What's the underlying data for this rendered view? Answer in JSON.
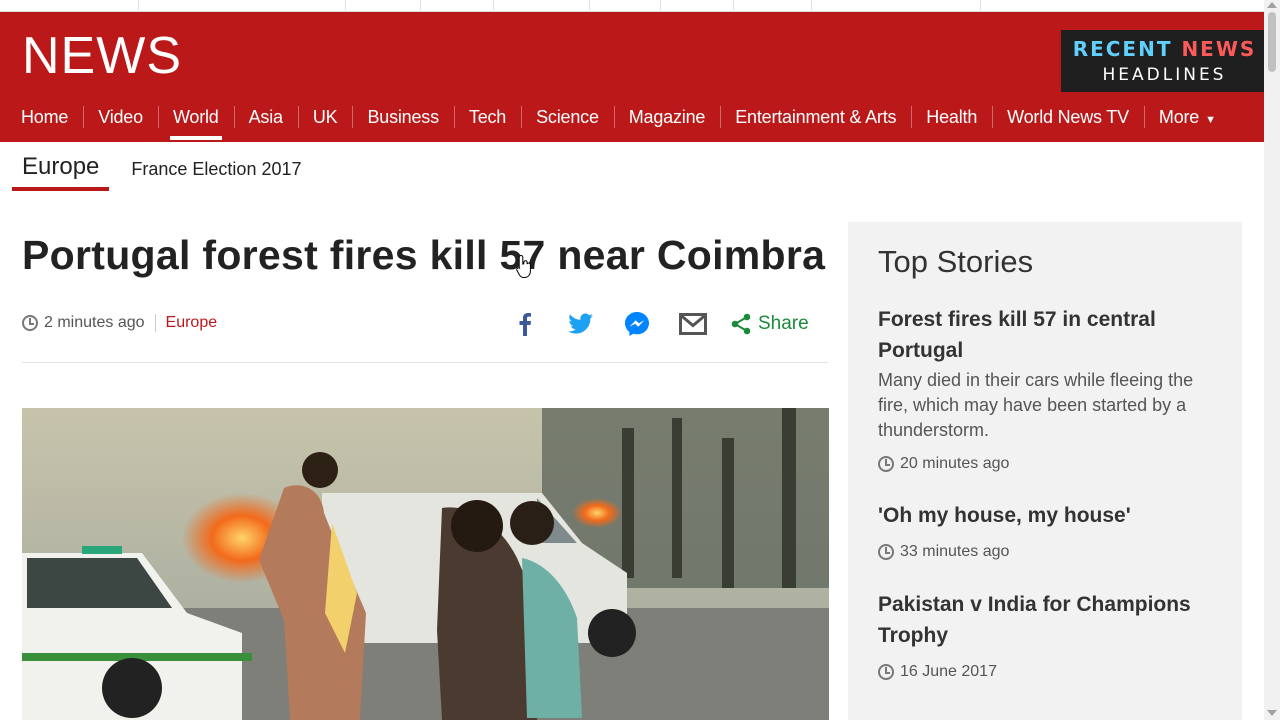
{
  "brand": {
    "logo": "NEWS",
    "color": "#bb1919"
  },
  "badge": {
    "line1a": "RECENT ",
    "line1b": "NEWS",
    "line2": "HEADLINES"
  },
  "nav": {
    "items": [
      "Home",
      "Video",
      "World",
      "Asia",
      "UK",
      "Business",
      "Tech",
      "Science",
      "Magazine",
      "Entertainment & Arts",
      "Health",
      "World News TV",
      "More"
    ],
    "active": "World"
  },
  "subnav": {
    "section": "Europe",
    "link": "France Election 2017"
  },
  "article": {
    "headline": "Portugal forest fires kill 57 near Coimbra",
    "time": "2 minutes ago",
    "category": "Europe",
    "share_label": "Share",
    "share_icons": [
      "facebook-icon",
      "twitter-icon",
      "messenger-icon",
      "email-icon",
      "share-icon"
    ]
  },
  "sidebar": {
    "title": "Top Stories",
    "stories": [
      {
        "title": "Forest fires kill 57 in central Portugal",
        "summary": "Many died in their cars while fleeing the fire, which may have been started by a thunderstorm.",
        "time": "20 minutes ago"
      },
      {
        "title": "'Oh my house, my house'",
        "summary": "",
        "time": "33 minutes ago"
      },
      {
        "title": "Pakistan v India for Champions Trophy",
        "summary": "",
        "time": "16 June 2017"
      }
    ]
  }
}
